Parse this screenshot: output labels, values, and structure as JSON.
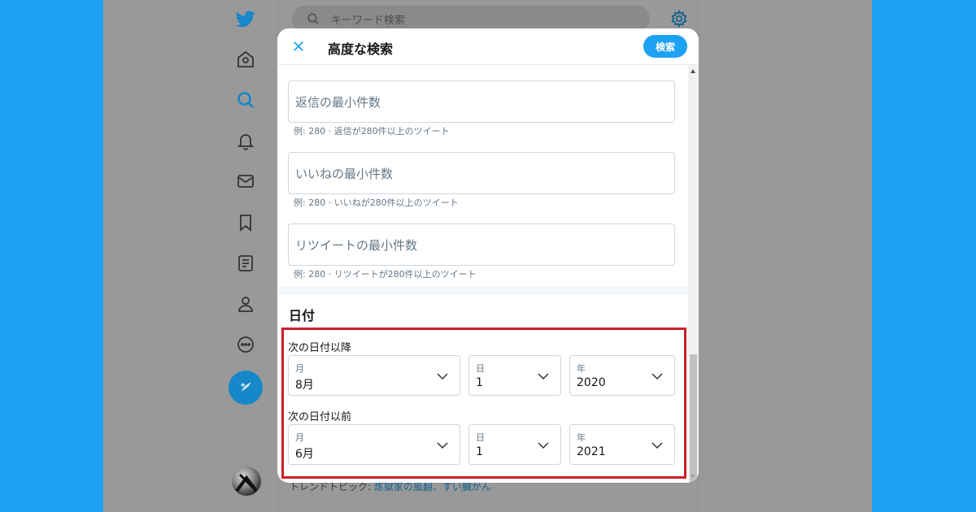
{
  "colors": {
    "page_bg": "#1da1f2",
    "app_bg_dimmed": "#999999",
    "accent": "#1da1f2",
    "highlight": "#cc1f2a",
    "text_primary": "#14171a",
    "text_secondary": "#657786"
  },
  "nav": {
    "icons": [
      "twitter-bird-icon",
      "home-icon",
      "search-icon",
      "bell-icon",
      "mail-icon",
      "bookmark-icon",
      "list-icon",
      "profile-icon",
      "more-icon"
    ],
    "compose_icon": "compose-icon"
  },
  "top_search": {
    "placeholder": "キーワード検索"
  },
  "trend": {
    "prefix": "トレンドトピック:",
    "link_text": "炼獄家の風翻、すい臓がん"
  },
  "modal": {
    "title": "高度な検索",
    "search_button": "検索",
    "fields": [
      {
        "placeholder": "返信の最小件数",
        "hint": "例: 280 · 返信が280件以上のツイート"
      },
      {
        "placeholder": "いいねの最小件数",
        "hint": "例: 280 · いいねが280件以上のツイート"
      },
      {
        "placeholder": "リツイートの最小件数",
        "hint": "例: 280 · リツイートが280件以上のツイート"
      }
    ],
    "date_section": {
      "title": "日付",
      "since": {
        "label": "次の日付以降",
        "month": {
          "label": "月",
          "value": "8月"
        },
        "day": {
          "label": "日",
          "value": "1"
        },
        "year": {
          "label": "年",
          "value": "2020"
        }
      },
      "until": {
        "label": "次の日付以前",
        "month": {
          "label": "月",
          "value": "6月"
        },
        "day": {
          "label": "日",
          "value": "1"
        },
        "year": {
          "label": "年",
          "value": "2021"
        }
      }
    }
  }
}
